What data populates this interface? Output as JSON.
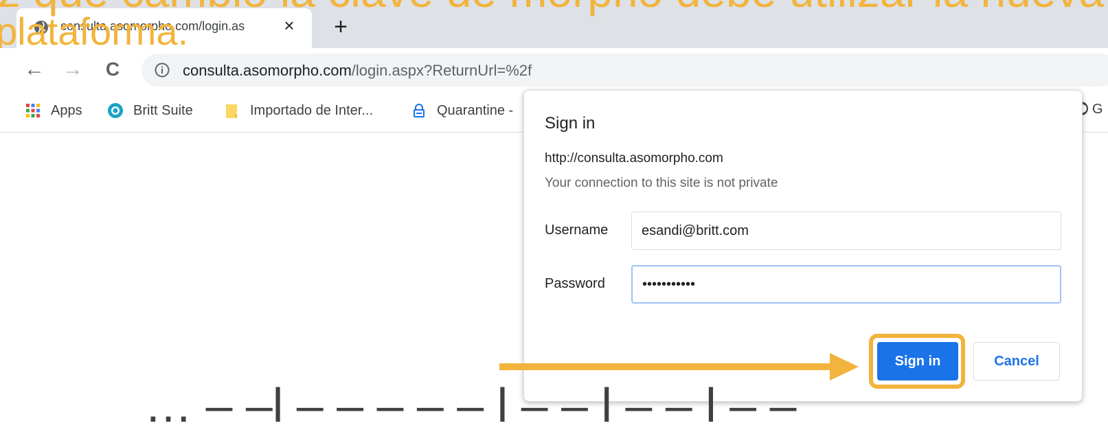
{
  "overlay": {
    "top_text": "ez que cambió la clave de morpho debe utilizar la nueva",
    "platform_text": "plataforma.",
    "bottom_text": "… – –l – – – – – l – – l – – l – –",
    "accent_color": "#f2b43c"
  },
  "browser": {
    "tab": {
      "title": "consulta.asomorpho.com/login.as",
      "icon": "globe-icon",
      "close_glyph": "×"
    },
    "new_tab_glyph": "+",
    "nav": {
      "back_glyph": "←",
      "forward_glyph": "→",
      "reload_glyph": "C"
    },
    "url": {
      "host": "consulta.asomorpho.com",
      "path": "/login.aspx?ReturnUrl=%2f"
    },
    "bookmarks": [
      {
        "label": "Apps",
        "icon": "apps-grid-icon"
      },
      {
        "label": "Britt Suite",
        "icon": "britt-suite-icon"
      },
      {
        "label": "Importado de Inter...",
        "icon": "folder-icon"
      },
      {
        "label": "Quarantine -",
        "icon": "lock-icon"
      }
    ],
    "bookmark_right_partial": "G"
  },
  "dialog": {
    "title": "Sign in",
    "origin": "http://consulta.asomorpho.com",
    "warning": "Your connection to this site is not private",
    "username_label": "Username",
    "username_value": "esandi@britt.com",
    "password_label": "Password",
    "password_value": "•••••••••••",
    "sign_in_label": "Sign in",
    "cancel_label": "Cancel",
    "primary_color": "#1a73e8"
  }
}
